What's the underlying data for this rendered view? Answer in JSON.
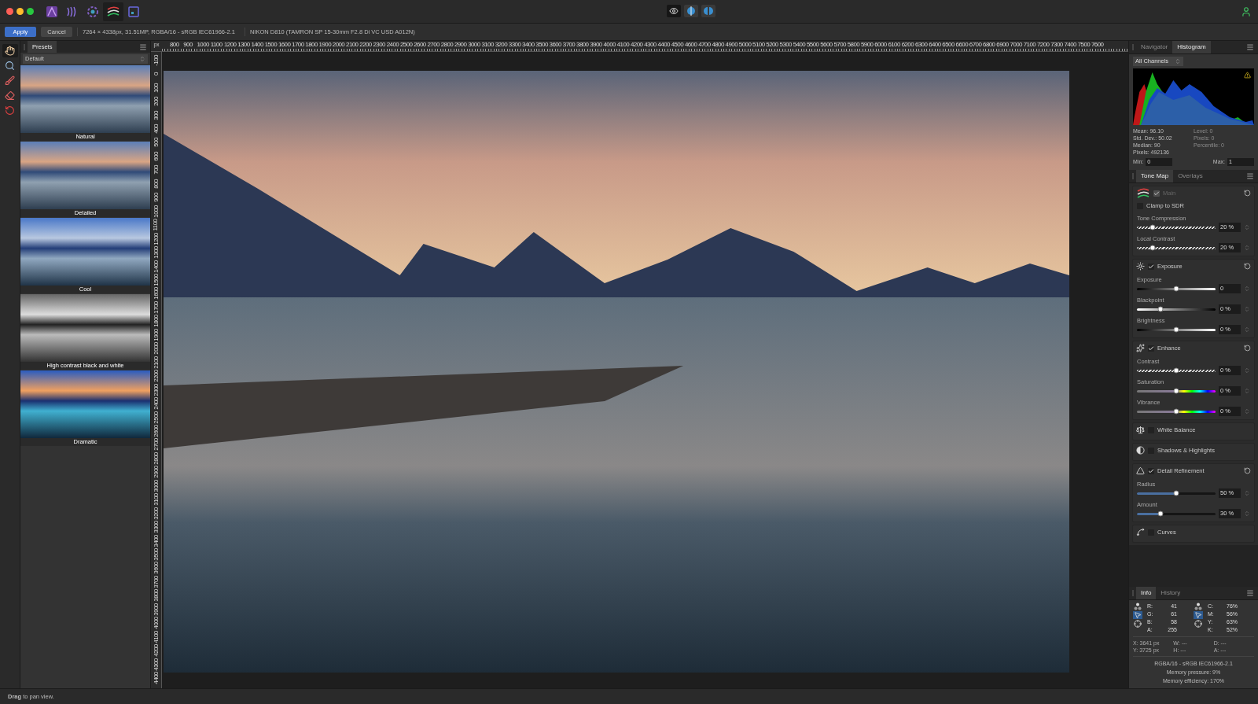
{
  "title_bar": {
    "personas": [
      {
        "kind": "photo",
        "selected": false
      },
      {
        "kind": "liquify",
        "selected": false
      },
      {
        "kind": "develop",
        "selected": false
      },
      {
        "kind": "tonemap",
        "selected": true
      },
      {
        "kind": "export",
        "selected": false
      }
    ],
    "view_modes": [
      {
        "kind": "eye",
        "selected": true
      },
      {
        "kind": "split",
        "selected": false
      },
      {
        "kind": "mirror",
        "selected": false
      }
    ]
  },
  "context_bar": {
    "buttons": [
      {
        "label": "Apply",
        "primary": true
      },
      {
        "label": "Cancel",
        "primary": false
      }
    ],
    "document_info": "7264 × 4338px, 31.51MP, RGBA/16 - sRGB IEC61966-2.1",
    "camera_info": "NIKON D810 (TAMRON SP 15-30mm F2.8 Di VC USD A012N)"
  },
  "tools": [
    {
      "kind": "hand",
      "selected": true
    },
    {
      "kind": "zoom",
      "selected": false
    },
    {
      "kind": "brush",
      "selected": false
    },
    {
      "kind": "eraser",
      "selected": false
    },
    {
      "kind": "restore",
      "selected": false
    }
  ],
  "presets_panel": {
    "tab": "Presets",
    "category": "Default",
    "presets": [
      {
        "name": "Natural"
      },
      {
        "name": "Detailed"
      },
      {
        "name": "Cool"
      },
      {
        "name": "High contrast black and white"
      },
      {
        "name": "Dramatic"
      }
    ]
  },
  "rulers": {
    "unit": "px",
    "horizontal": [
      "800",
      "900",
      "1000",
      "1100",
      "1200",
      "1300",
      "1400",
      "1500",
      "1600",
      "1700",
      "1800",
      "1900",
      "2000",
      "2100",
      "2200",
      "2300",
      "2400",
      "2500",
      "2600",
      "2700",
      "2800",
      "2900",
      "3000",
      "3100",
      "3200",
      "3300",
      "3400",
      "3500",
      "3600",
      "3700",
      "3800",
      "3900",
      "4000",
      "4100",
      "4200",
      "4300",
      "4400",
      "4500",
      "4600",
      "4700",
      "4800",
      "4900",
      "5000",
      "5100",
      "5200",
      "5300",
      "5400",
      "5500",
      "5600",
      "5700",
      "5800",
      "5900",
      "6000",
      "6100",
      "6200",
      "6300",
      "6400",
      "6500",
      "6600",
      "6700",
      "6800",
      "6900",
      "7000",
      "7100",
      "7200",
      "7300",
      "7400",
      "7500",
      "7600"
    ],
    "vertical": [
      "-100",
      "0",
      "100",
      "200",
      "300",
      "400",
      "500",
      "600",
      "700",
      "800",
      "900",
      "1000",
      "1100",
      "1200",
      "1300",
      "1400",
      "1500",
      "1600",
      "1700",
      "1800",
      "1900",
      "2000",
      "2100",
      "2200",
      "2300",
      "2400",
      "2500",
      "2600",
      "2700",
      "2800",
      "2900",
      "3000",
      "3100",
      "3200",
      "3300",
      "3400",
      "3500",
      "3600",
      "3700",
      "3800",
      "3900",
      "4000",
      "4100",
      "4200",
      "4300",
      "4400"
    ]
  },
  "histogram_panel": {
    "tabs": [
      {
        "label": "Navigator",
        "selected": false
      },
      {
        "label": "Histogram",
        "selected": true
      }
    ],
    "channel": "All Channels",
    "stats": [
      "Mean: 96.10",
      "Std. Dev.: 50.02",
      "Median: 90",
      "Pixels: 492136"
    ],
    "cursor_stats": [
      "Level: 0",
      "Pixels: 0",
      "Percentile: 0"
    ],
    "min": {
      "label": "Min:",
      "value": "0"
    },
    "max": {
      "label": "Max:",
      "value": "1"
    }
  },
  "tone_map_panel": {
    "tabs": [
      {
        "label": "Tone Map",
        "selected": true
      },
      {
        "label": "Overlays",
        "selected": false
      }
    ],
    "sections": [
      {
        "title": "Main",
        "checked": true,
        "disabled": true,
        "controls": [
          {
            "kind": "checkbox",
            "label": "Clamp to SDR",
            "checked": false
          },
          {
            "kind": "checker_slider",
            "label": "Tone Compression",
            "level": 0.2,
            "value": "20 %"
          },
          {
            "kind": "checker_slider",
            "label": "Local Contrast",
            "level": 0.2,
            "value": "20 %"
          }
        ]
      },
      {
        "title": "Exposure",
        "checked": true,
        "disabled": false,
        "controls": [
          {
            "kind": "gradient_slider",
            "label": "Exposure",
            "level": 0.5,
            "value": "0"
          },
          {
            "kind": "reverse_gradient_slider",
            "label": "Blackpoint",
            "level": 0.3,
            "value": "0 %"
          },
          {
            "kind": "gradient_slider",
            "label": "Brightness",
            "level": 0.5,
            "value": "0 %"
          }
        ]
      },
      {
        "title": "Enhance",
        "checked": true,
        "disabled": false,
        "controls": [
          {
            "kind": "checker_slider",
            "label": "Contrast",
            "level": 0.5,
            "value": "0 %"
          },
          {
            "kind": "spectrum_slider",
            "label": "Saturation",
            "level": 0.5,
            "value": "0 %"
          },
          {
            "kind": "spectrum_slider",
            "label": "Vibrance",
            "level": 0.5,
            "value": "0 %"
          }
        ]
      },
      {
        "title": "White Balance",
        "checked": false,
        "disabled": false
      },
      {
        "title": "Shadows & Highlights",
        "checked": false,
        "disabled": false
      },
      {
        "title": "Detail Refinement",
        "checked": true,
        "disabled": false,
        "controls": [
          {
            "kind": "fill_slider",
            "label": "Radius",
            "level": 0.5,
            "value": "50 %"
          },
          {
            "kind": "fill_slider",
            "label": "Amount",
            "level": 0.3,
            "value": "30 %"
          }
        ]
      },
      {
        "title": "Curves",
        "checked": false,
        "disabled": false
      }
    ]
  },
  "info_panel": {
    "tabs": [
      {
        "label": "Info",
        "selected": true
      },
      {
        "label": "History",
        "selected": false
      }
    ],
    "samplers": [
      {
        "modes": [
          {
            "kind": "dots",
            "selected": false
          },
          {
            "kind": "pointer",
            "selected": true
          },
          {
            "kind": "crosshair",
            "selected": false
          }
        ],
        "channels": [
          {
            "label": "R:",
            "value": "41"
          },
          {
            "label": "G:",
            "value": "61"
          },
          {
            "label": "B:",
            "value": "58"
          },
          {
            "label": "A:",
            "value": "255"
          }
        ]
      },
      {
        "modes": [
          {
            "kind": "dots",
            "selected": false
          },
          {
            "kind": "pointer",
            "selected": true
          },
          {
            "kind": "crosshair",
            "selected": false
          }
        ],
        "channels": [
          {
            "label": "C:",
            "value": "76%"
          },
          {
            "label": "M:",
            "value": "56%"
          },
          {
            "label": "Y:",
            "value": "63%"
          },
          {
            "label": "K:",
            "value": "52%"
          }
        ]
      }
    ],
    "position": [
      [
        "X: 3641 px",
        "Y: 3725 px"
      ],
      [
        "W: ---",
        "H: ---"
      ],
      [
        "D: ---",
        "A: ---"
      ]
    ],
    "footer": [
      "RGBA/16 - sRGB IEC61966-2.1",
      "Memory pressure: 9%",
      "Memory efficiency: 170%"
    ]
  },
  "status_bar": "**Drag** to pan view."
}
